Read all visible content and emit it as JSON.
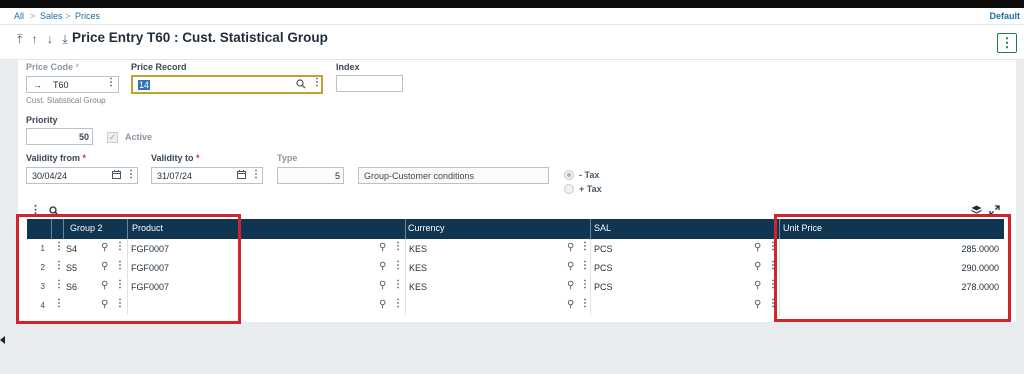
{
  "breadcrumb": {
    "all": "All",
    "sales": "Sales",
    "prices": "Prices",
    "sep": ">",
    "right": "Default"
  },
  "header": {
    "arrows": [
      "⤒",
      "↑",
      "↓",
      "⤓"
    ],
    "title": "Price Entry T60 : Cust. Statistical Group",
    "more_icon": "⋮"
  },
  "form": {
    "price_code": {
      "label": "Price Code",
      "marker": "*",
      "value": "T60",
      "arrow": "→",
      "subtext": "Cust. Statistical Group"
    },
    "price_record": {
      "label": "Price Record",
      "value": "14"
    },
    "index": {
      "label": "Index",
      "value": ""
    },
    "priority": {
      "label": "Priority",
      "value": "50"
    },
    "active": {
      "label": "Active",
      "checked": true
    },
    "validity_from": {
      "label": "Validity from",
      "value": "30/04/24"
    },
    "validity_to": {
      "label": "Validity to",
      "value": "31/07/24"
    },
    "type": {
      "label": "Type",
      "value": "5",
      "description": "Group-Customer conditions"
    },
    "tax": {
      "minus_label": "- Tax",
      "plus_label": "+ Tax",
      "selected": "- Tax"
    }
  },
  "grid": {
    "columns": [
      "Group 2",
      "Product",
      "Currency",
      "SAL",
      "Unit Price"
    ],
    "rows": [
      {
        "num": "1",
        "group": "S4",
        "product": "FGF0007",
        "currency": "KES",
        "sal": "PCS",
        "unit_price": "285.0000"
      },
      {
        "num": "2",
        "group": "S5",
        "product": "FGF0007",
        "currency": "KES",
        "sal": "PCS",
        "unit_price": "290.0000"
      },
      {
        "num": "3",
        "group": "S6",
        "product": "FGF0007",
        "currency": "KES",
        "sal": "PCS",
        "unit_price": "278.0000"
      },
      {
        "num": "4",
        "group": "",
        "product": "",
        "currency": "",
        "sal": "",
        "unit_price": ""
      }
    ]
  },
  "colors": {
    "grid_header": "#0f3550",
    "highlight_red": "#d0252b",
    "accent_green": "#1e7b4a",
    "focus_gold": "#c8a032"
  }
}
